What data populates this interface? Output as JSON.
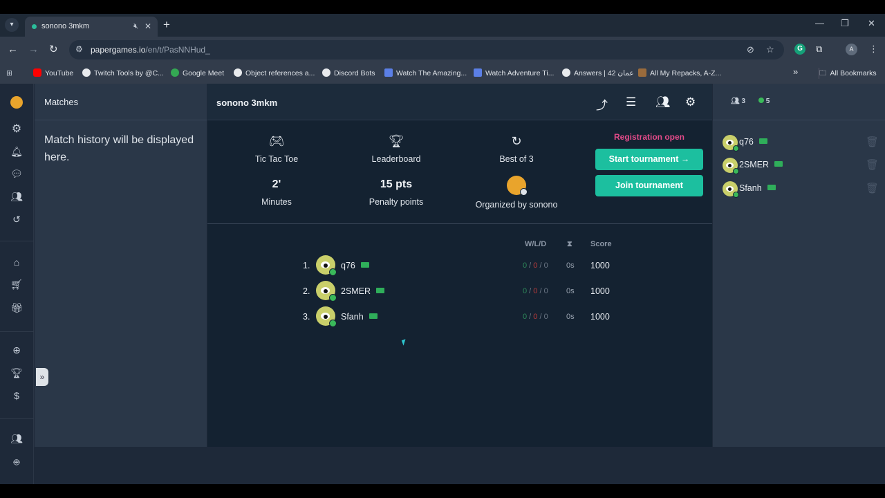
{
  "browser": {
    "tab_title": "sonono 3mkm",
    "url_host": "papergames.io",
    "url_path": "/en/t/PasNNHud_",
    "bookmarks": [
      {
        "label": "YouTube",
        "color": "#ff0000"
      },
      {
        "label": "Twitch Tools by @C...",
        "color": "#e8eaed"
      },
      {
        "label": "Google Meet",
        "color": "#34a853"
      },
      {
        "label": "Object references a...",
        "color": "#e8eaed"
      },
      {
        "label": "Discord Bots",
        "color": "#e8eaed"
      },
      {
        "label": "Watch The Amazing...",
        "color": "#5b7fe6"
      },
      {
        "label": "Watch Adventure Ti...",
        "color": "#5b7fe6"
      },
      {
        "label": "Answers | 42 عمان",
        "color": "#e8eaed"
      },
      {
        "label": "All My Repacks, A-Z...",
        "color": "#9a6b3c"
      }
    ],
    "all_bookmarks": "All Bookmarks",
    "more": "»",
    "avatar_letter": "A"
  },
  "matches": {
    "title": "Matches",
    "empty_text": "Match history will be displayed here."
  },
  "tournament": {
    "title": "sonono 3mkm",
    "game": "Tic Tac Toe",
    "leaderboard_label": "Leaderboard",
    "format": "Best of 3",
    "time_value": "2'",
    "time_unit": "Minutes",
    "penalty_value": "15 pts",
    "penalty_label": "Penalty points",
    "organizer": "Organized by sonono",
    "registration": "Registration open",
    "start_button": "Start tournament →",
    "join_button": "Join tournament"
  },
  "leaderboard": {
    "col_wld": "W/L/D",
    "col_time": "⧗",
    "col_score": "Score",
    "rows": [
      {
        "rank": "1.",
        "name": "q76",
        "w": "0",
        "l": "0",
        "d": "0",
        "time": "0s",
        "score": "1000"
      },
      {
        "rank": "2.",
        "name": "2SMER",
        "w": "0",
        "l": "0",
        "d": "0",
        "time": "0s",
        "score": "1000"
      },
      {
        "rank": "3.",
        "name": "Sfanh",
        "w": "0",
        "l": "0",
        "d": "0",
        "time": "0s",
        "score": "1000"
      }
    ]
  },
  "participants": {
    "count": "3",
    "online": "5",
    "players": [
      "q76",
      "2SMER",
      "Sfanh"
    ]
  },
  "colors": {
    "accent": "#1cbf9f",
    "registration": "#e44b8a",
    "online": "#3ab95a"
  }
}
